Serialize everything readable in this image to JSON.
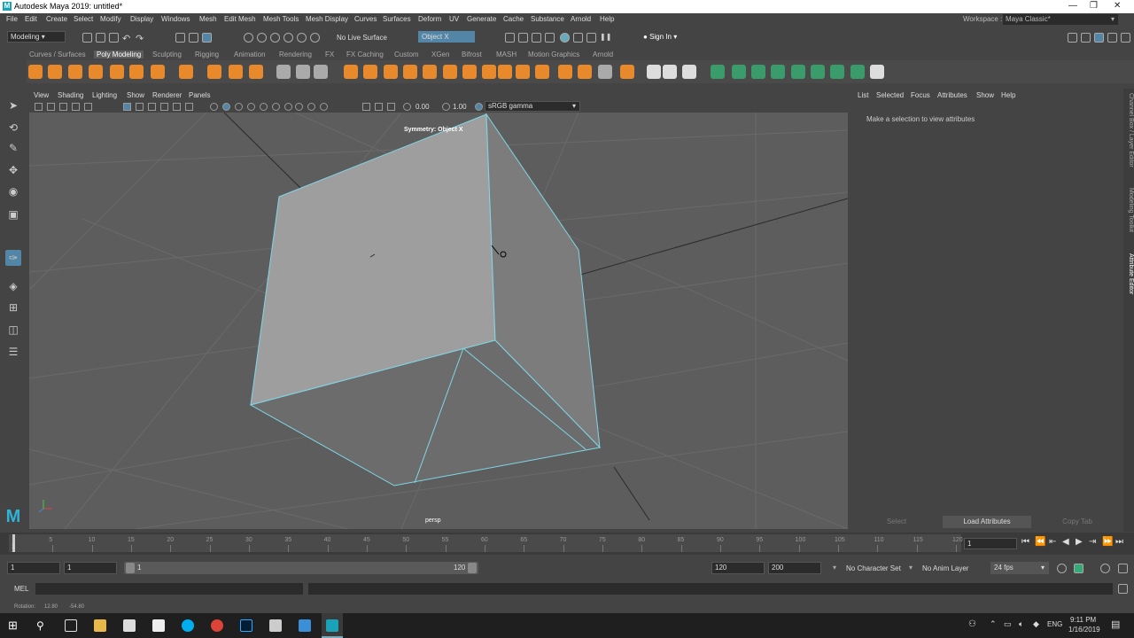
{
  "window": {
    "title": "Autodesk Maya 2019: untitled*",
    "logo_letter": "M"
  },
  "menu": [
    "File",
    "Edit",
    "Create",
    "Select",
    "Modify",
    "Display",
    "Windows",
    "Mesh",
    "Edit Mesh",
    "Mesh Tools",
    "Mesh Display",
    "Curves",
    "Surfaces",
    "Deform",
    "UV",
    "Generate",
    "Cache",
    "Substance",
    "Arnold",
    "Help"
  ],
  "workspace": {
    "label": "Workspace :",
    "value": "Maya Classic*"
  },
  "statusline": {
    "mode": "Modeling",
    "live_surface": "No Live Surface",
    "symmetry": "Object X",
    "sign_in": "Sign In"
  },
  "shelf_tabs": [
    "Curves / Surfaces",
    "Poly Modeling",
    "Sculpting",
    "Rigging",
    "Animation",
    "Rendering",
    "FX",
    "FX Caching",
    "Custom",
    "XGen",
    "Bifrost",
    "MASH",
    "Motion Graphics",
    "Arnold"
  ],
  "shelf_active": "Poly Modeling",
  "viewport": {
    "menu": [
      "View",
      "Shading",
      "Lighting",
      "Show",
      "Renderer",
      "Panels"
    ],
    "exposure": "0.00",
    "gamma": "1.00",
    "color_space": "sRGB gamma",
    "symmetry_label": "Symmetry: Object X",
    "camera": "persp"
  },
  "attribute_editor": {
    "menu": [
      "List",
      "Selected",
      "Focus",
      "Attributes",
      "Show",
      "Help"
    ],
    "message": "Make a selection to view attributes",
    "buttons": [
      "Select",
      "Load Attributes",
      "Copy Tab"
    ]
  },
  "side_tabs": [
    "Channel Box / Layer Editor",
    "Modeling Toolkit",
    "Attribute Editor"
  ],
  "time_slider": {
    "ticks": [
      "5",
      "10",
      "15",
      "20",
      "25",
      "30",
      "35",
      "40",
      "45",
      "50",
      "55",
      "60",
      "65",
      "70",
      "75",
      "80",
      "85",
      "90",
      "95",
      "100",
      "105",
      "110",
      "115",
      "120"
    ],
    "first": "1",
    "current_frame": "1"
  },
  "range": {
    "start": "1",
    "start_inner": "1",
    "range_start": "1",
    "range_end": "120",
    "end_inner": "120",
    "end": "200",
    "character_set": "No Character Set",
    "anim_layer": "No Anim Layer",
    "fps": "24 fps"
  },
  "mel": {
    "label": "MEL"
  },
  "help_line": {
    "label": "Rotation:",
    "x": "12.80",
    "y": "-54.80"
  },
  "taskbar": {
    "time": "9:11 PM",
    "date": "1/16/2019",
    "lang": "ENG"
  },
  "colors": {
    "accent": "#5285a6",
    "wire": "#7fd7e8",
    "face": "#9e9e9e"
  }
}
